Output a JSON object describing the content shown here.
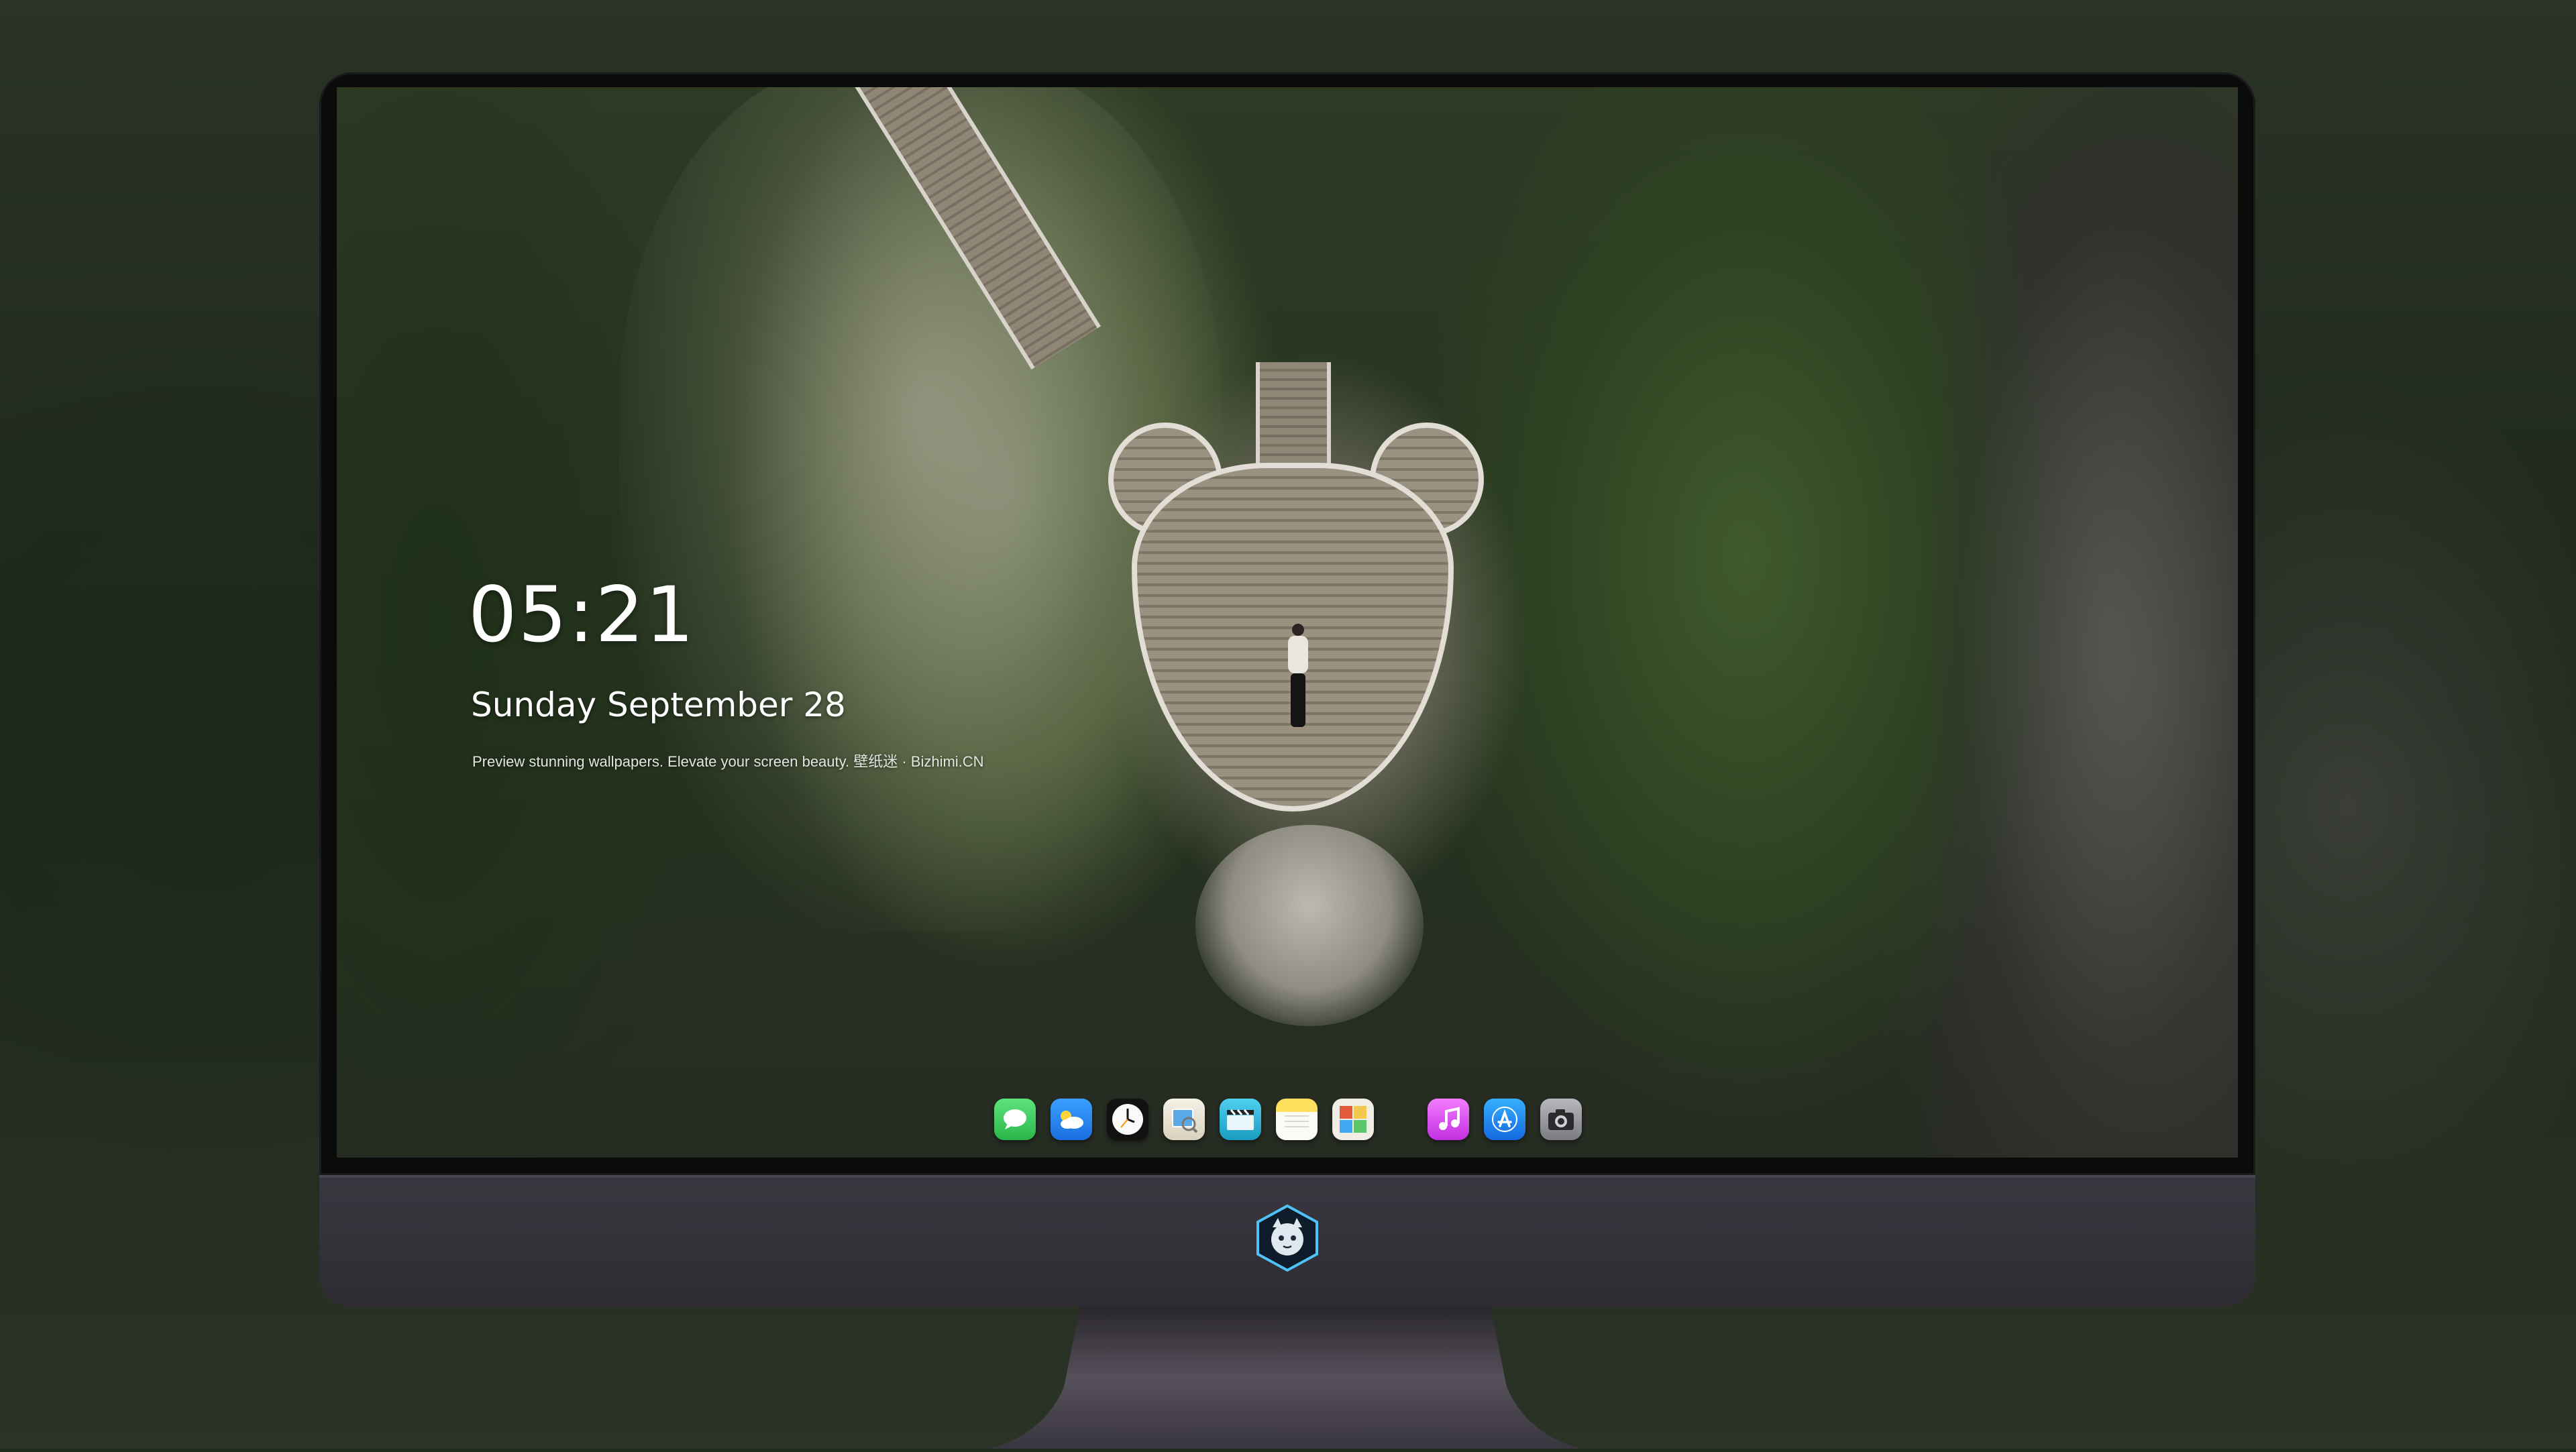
{
  "lockscreen": {
    "time": "05:21",
    "date": "Sunday September  28",
    "tagline": "Preview stunning wallpapers. Elevate your screen beauty. 壁纸迷 · Bizhimi.CN"
  },
  "dock": {
    "items": [
      {
        "name": "messages-icon",
        "color": "#34c759"
      },
      {
        "name": "weather-icon",
        "color": "#1e8bff"
      },
      {
        "name": "clock-icon",
        "color": "#111111"
      },
      {
        "name": "preview-icon",
        "color": "#f2c94c"
      },
      {
        "name": "clips-icon",
        "color": "#2bb7d6"
      },
      {
        "name": "notes-icon",
        "color": "#ffd54a"
      },
      {
        "name": "photo-booth-icon",
        "color": "#e45b3c"
      },
      {
        "name": "music-icon",
        "color": "#e040fb"
      },
      {
        "name": "app-store-icon",
        "color": "#1f8ef1"
      },
      {
        "name": "camera-icon",
        "color": "#8e8e93"
      }
    ]
  },
  "colors": {
    "bezel": "#0b0b0c",
    "chin": "#3b3740",
    "text": "#ffffff"
  }
}
